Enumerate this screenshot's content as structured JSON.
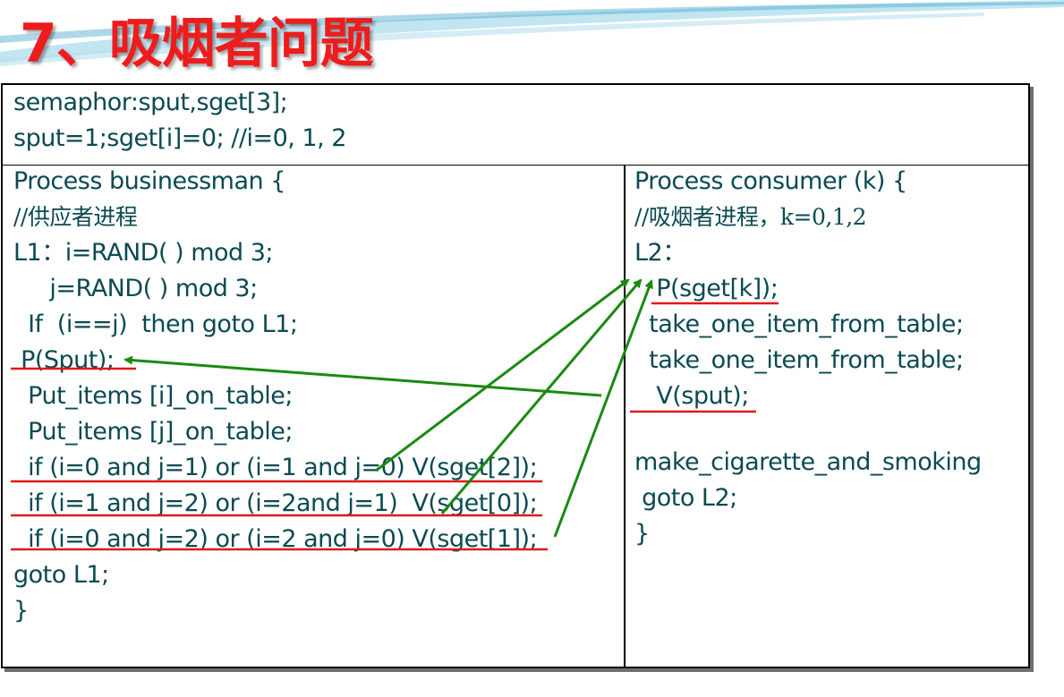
{
  "slide": {
    "title": "7、吸烟者问题"
  },
  "colors": {
    "title": "#ee1c1c",
    "code_text": "#0b4a52",
    "arrow": "#1a8a10",
    "underline": "#e0181b"
  },
  "declarations": [
    "semaphor:sput,sget[3];",
    "sput=1;sget[i]=0; //i=0, 1, 2"
  ],
  "businessman": {
    "lines": [
      "Process businessman {",
      "//供应者进程",
      "L1：i=RAND( ) mod 3;",
      "     j=RAND( ) mod 3;",
      "  If  (i==j)  then goto L1;",
      " P(Sput);",
      "  Put_items [i]_on_table;",
      "  Put_items [j]_on_table;",
      "  if (i=0 and j=1) or (i=1 and j=0) V(sget[2]);",
      "  if (i=1 and j=2) or (i=2and j=1)  V(sget[0]);",
      "  if (i=0 and j=2) or (i=2 and j=0) V(sget[1]);",
      "goto L1;",
      "}"
    ]
  },
  "consumer": {
    "lines": [
      "Process consumer (k) {",
      "//吸烟者进程，k=0,1,2",
      "L2：",
      "   P(sget[k]);",
      "  take_one_item_from_table;",
      "  take_one_item_from_table;",
      "   V(sput);",
      "",
      "make_cigarette_and_smoking",
      " goto L2;",
      "}"
    ]
  }
}
